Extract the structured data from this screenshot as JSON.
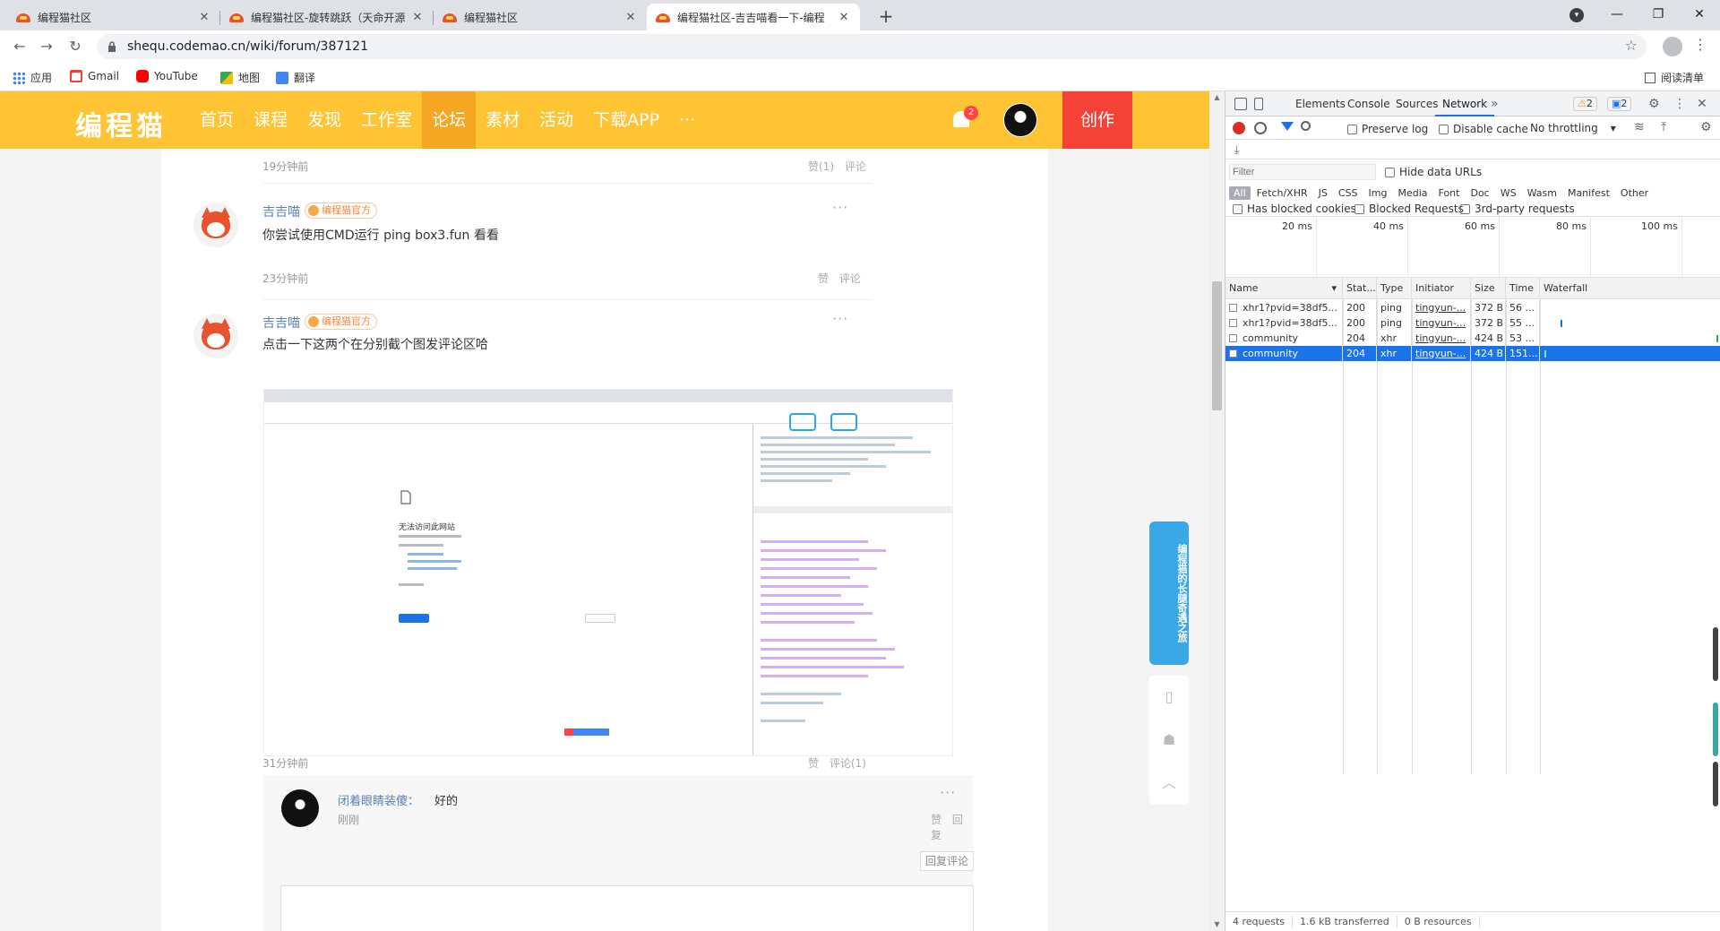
{
  "tabs": [
    {
      "title": "编程猫社区",
      "active": false
    },
    {
      "title": "编程猫社区-旋转跳跃（天命开源",
      "active": false
    },
    {
      "title": "编程猫社区",
      "active": false
    },
    {
      "title": "编程猫社区-吉吉喵看一下-编程",
      "active": true
    }
  ],
  "address": {
    "url": "shequ.codemao.cn/wiki/forum/387121"
  },
  "bookmarks": [
    "应用",
    "Gmail",
    "YouTube",
    "地图",
    "翻译"
  ],
  "reading_list": "阅读清单",
  "site": {
    "logo": "编程猫",
    "nav": [
      "首页",
      "课程",
      "发现",
      "工作室",
      "论坛",
      "素材",
      "活动",
      "下载APP",
      "···"
    ],
    "active_nav": "论坛",
    "notification_count": "2",
    "create_label": "创作"
  },
  "posts": [
    {
      "time": "19分钟前",
      "like": "赞(1)",
      "comment": "评论"
    },
    {
      "user": "吉吉喵",
      "badge": "编程猫官方",
      "text": "你尝试使用CMD运行 ping box3.fun 看看",
      "time": "23分钟前",
      "like": "赞",
      "comment": "评论",
      "more": "···"
    },
    {
      "user": "吉吉喵",
      "badge": "编程猫官方",
      "text": "点击一下这两个在分别截个图发评论区哈",
      "time": "31分钟前",
      "like": "赞",
      "comment": "评论(1)",
      "more": "···"
    }
  ],
  "screenshot": {
    "error_title": "无法访问此网站"
  },
  "reply": {
    "user": "闭着眼睛装傻：",
    "text": "好的",
    "time": "刚刚",
    "like": "赞",
    "reply": "回复",
    "more": "···",
    "reply_comment_button": "回复评论"
  },
  "side_ad": {
    "text": "编程猫的长腿奇遇之旅"
  },
  "devtools": {
    "tabs": [
      "Elements",
      "Console",
      "Sources",
      "Network"
    ],
    "active_tab": "Network",
    "warn_count": "2",
    "msg_count": "2",
    "preserve_log": "Preserve log",
    "disable_cache": "Disable cache",
    "throttling": "No throttling",
    "filter_placeholder": "Filter",
    "hide_data_urls": "Hide data URLs",
    "type_filters": [
      "All",
      "Fetch/XHR",
      "JS",
      "CSS",
      "Img",
      "Media",
      "Font",
      "Doc",
      "WS",
      "Wasm",
      "Manifest",
      "Other"
    ],
    "has_blocked_cookies": "Has blocked cookies",
    "blocked_requests": "Blocked Requests",
    "third_party": "3rd-party requests",
    "timeline_labels": [
      "20 ms",
      "40 ms",
      "60 ms",
      "80 ms",
      "100 ms"
    ],
    "columns": [
      "Name",
      "Stat...",
      "Type",
      "Initiator",
      "Size",
      "Time",
      "Waterfall"
    ],
    "requests": [
      {
        "name": "xhr1?pvid=38df5...",
        "status": "200",
        "type": "ping",
        "initiator": "tingyun-...",
        "size": "372 B",
        "time": "56 ...",
        "selected": false
      },
      {
        "name": "xhr1?pvid=38df5...",
        "status": "200",
        "type": "ping",
        "initiator": "tingyun-...",
        "size": "372 B",
        "time": "55 ...",
        "selected": false
      },
      {
        "name": "community",
        "status": "204",
        "type": "xhr",
        "initiator": "tingyun-...",
        "size": "424 B",
        "time": "53 ...",
        "selected": false
      },
      {
        "name": "community",
        "status": "204",
        "type": "xhr",
        "initiator": "tingyun-...",
        "size": "424 B",
        "time": "151...",
        "selected": true
      }
    ],
    "status_bar": [
      "4 requests",
      "1.6 kB transferred",
      "0 B resources"
    ]
  }
}
